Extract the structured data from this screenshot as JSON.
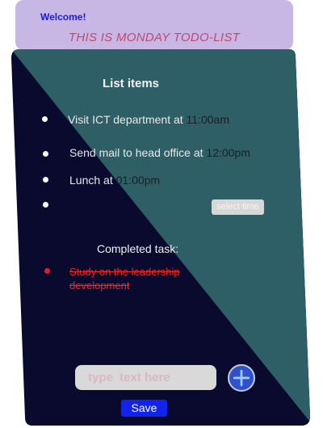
{
  "header": {
    "welcome": "Welcome!",
    "subtitle": "THIS IS MONDAY TODO-LIST"
  },
  "list": {
    "title": "List items",
    "items": [
      {
        "label": "Visit  ICT department at ",
        "time": "11:00am"
      },
      {
        "label": "Send mail to head office at ",
        "time": " 12:00pm"
      },
      {
        "label": "Lunch at ",
        "time": "01:00pm"
      },
      {
        "label": "",
        "time": ""
      }
    ],
    "select_time_label": "select time"
  },
  "completed": {
    "label": "Completed task:",
    "items": [
      "Study on the leadership development"
    ]
  },
  "composer": {
    "placeholder": "type  text here",
    "add_icon": "plus-icon",
    "save_label": "Save"
  },
  "colors": {
    "header_bg": "#c8b7e5",
    "card_dark": "#0a0a2e",
    "card_teal": "#2e5f66",
    "accent_blue": "#1223ee",
    "completed_red": "#e82828"
  }
}
